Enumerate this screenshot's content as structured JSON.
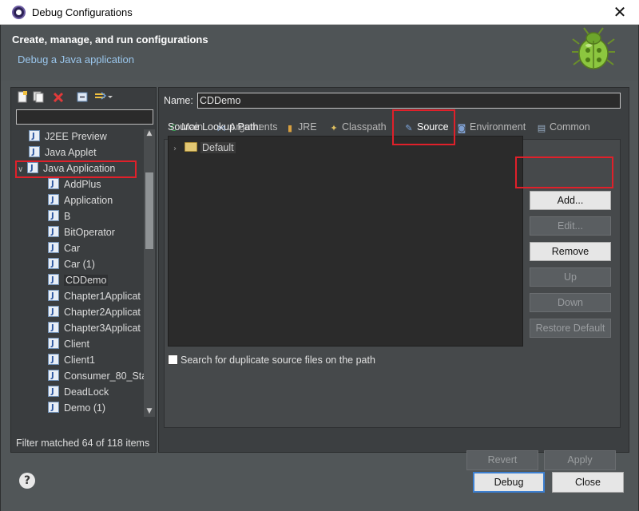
{
  "window": {
    "title": "Debug Configurations",
    "close_glyph": "✕"
  },
  "banner": {
    "title": "Create, manage, and run configurations",
    "subtitle": "Debug a Java application"
  },
  "left": {
    "filter_value": "",
    "tree": [
      {
        "label": "J2EE Preview",
        "icon": "j2ee-preview-icon",
        "level": 0
      },
      {
        "label": "Java Applet",
        "icon": "java-applet-icon",
        "level": 0
      },
      {
        "label": "Java Application",
        "icon": "java-application-icon",
        "level": 0,
        "expanded": true,
        "highlighted": true
      },
      {
        "label": "AddPlus",
        "icon": "java-class-icon",
        "level": 1
      },
      {
        "label": "Application",
        "icon": "java-class-icon",
        "level": 1
      },
      {
        "label": "B",
        "icon": "java-class-icon",
        "level": 1
      },
      {
        "label": "BitOperator",
        "icon": "java-class-icon",
        "level": 1
      },
      {
        "label": "Car",
        "icon": "java-class-icon",
        "level": 1
      },
      {
        "label": "Car (1)",
        "icon": "java-class-icon",
        "level": 1
      },
      {
        "label": "CDDemo",
        "icon": "java-class-icon",
        "level": 1,
        "selected": true
      },
      {
        "label": "Chapter1Applicat",
        "icon": "java-class-icon",
        "level": 1
      },
      {
        "label": "Chapter2Applicat",
        "icon": "java-class-icon",
        "level": 1
      },
      {
        "label": "Chapter3Applicat",
        "icon": "java-class-icon",
        "level": 1
      },
      {
        "label": "Client",
        "icon": "java-class-icon",
        "level": 1
      },
      {
        "label": "Client1",
        "icon": "java-class-icon",
        "level": 1
      },
      {
        "label": "Consumer_80_Sta",
        "icon": "java-class-icon",
        "level": 1
      },
      {
        "label": "DeadLock",
        "icon": "java-class-icon",
        "level": 1
      },
      {
        "label": "Demo (1)",
        "icon": "java-class-icon",
        "level": 1
      }
    ],
    "filter_status": "Filter matched 64 of 118 items"
  },
  "right": {
    "name_label": "Name:",
    "name_value": "CDDemo",
    "tabs": [
      {
        "label": "Main",
        "icon": "main-tab-icon",
        "glyph": "C"
      },
      {
        "label": "Arguments",
        "icon": "arguments-tab-icon",
        "glyph": "⋈"
      },
      {
        "label": "JRE",
        "icon": "jre-tab-icon",
        "glyph": "▮"
      },
      {
        "label": "Classpath",
        "icon": "classpath-tab-icon",
        "glyph": "✦"
      },
      {
        "label": "Source",
        "icon": "source-tab-icon",
        "glyph": "✎",
        "active": true
      },
      {
        "label": "Environment",
        "icon": "environment-tab-icon",
        "glyph": "◙"
      },
      {
        "label": "Common",
        "icon": "common-tab-icon",
        "glyph": "▤"
      }
    ],
    "source_lookup_label": "Source Lookup Path:",
    "source_entries": [
      {
        "label": "Default",
        "icon": "folder-icon"
      }
    ],
    "side_buttons": {
      "add": "Add...",
      "edit": "Edit...",
      "remove": "Remove",
      "up": "Up",
      "down": "Down",
      "restore": "Restore Default"
    },
    "dup_check_label": "Search for duplicate source files on the path",
    "dup_checked": false,
    "revert": "Revert",
    "apply": "Apply"
  },
  "footer": {
    "help_glyph": "?",
    "debug": "Debug",
    "close": "Close"
  },
  "colors": {
    "highlight_box": "#e0202a",
    "default_button_border": "#3c7fd0",
    "subtitle": "#9ac6ec"
  }
}
